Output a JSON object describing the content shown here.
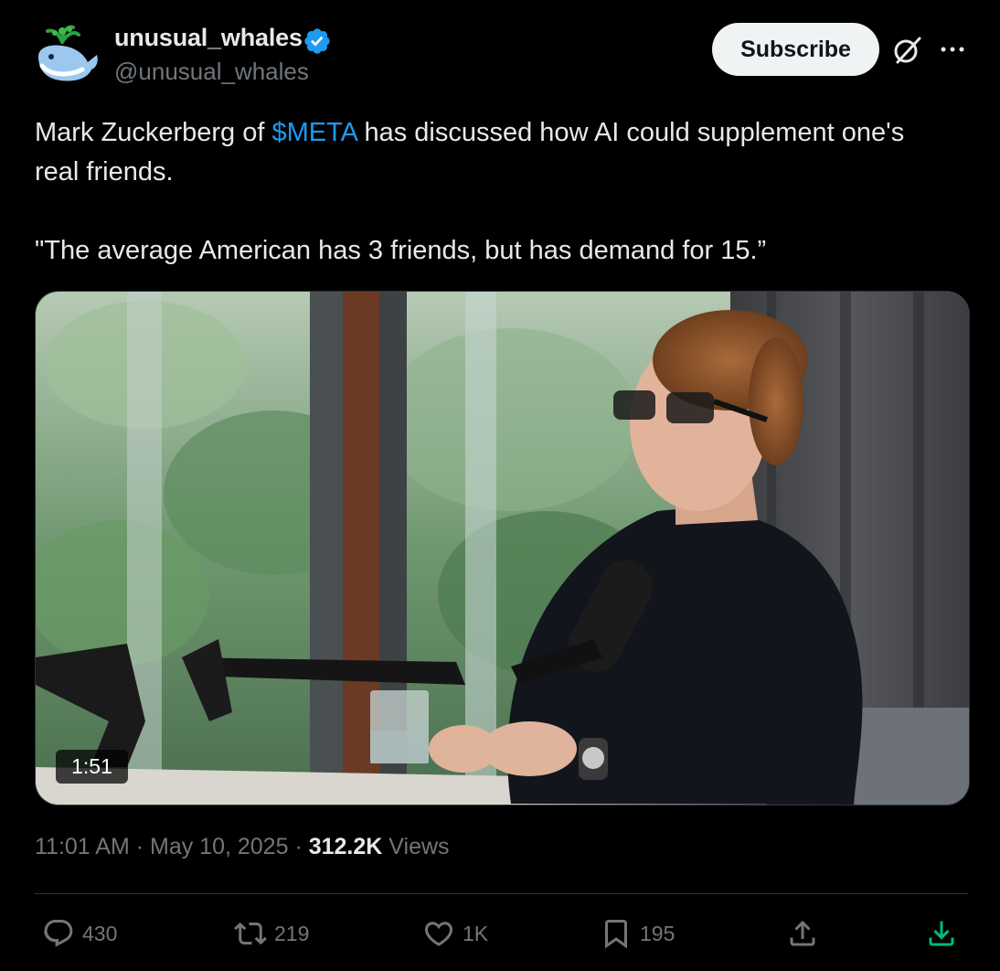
{
  "author": {
    "display_name": "unusual_whales",
    "handle": "@unusual_whales",
    "avatar_icon": "whale-avatar-icon",
    "verified_badge_color": "#1d9bf0"
  },
  "header": {
    "subscribe_label": "Subscribe",
    "grok_icon": "grok-icon",
    "more_icon": "more-dots-icon"
  },
  "tweet": {
    "text_before_cashtag": "Mark Zuckerberg of ",
    "cashtag": "$META",
    "text_after_cashtag": " has discussed how AI could supplement one's real friends.",
    "quote": "\"The average American has 3 friends, but has demand for 15.”"
  },
  "media": {
    "type": "video",
    "duration": "1:51"
  },
  "meta": {
    "time": "11:01 AM",
    "separator": " · ",
    "date": "May 10, 2025",
    "views_count": "312.2K",
    "views_label": " Views"
  },
  "actions": {
    "replies": "430",
    "reposts": "219",
    "likes": "1K",
    "bookmarks": "195"
  },
  "colors": {
    "background": "#000000",
    "text": "#e7e9ea",
    "muted": "#71767b",
    "accent": "#1d9bf0"
  }
}
